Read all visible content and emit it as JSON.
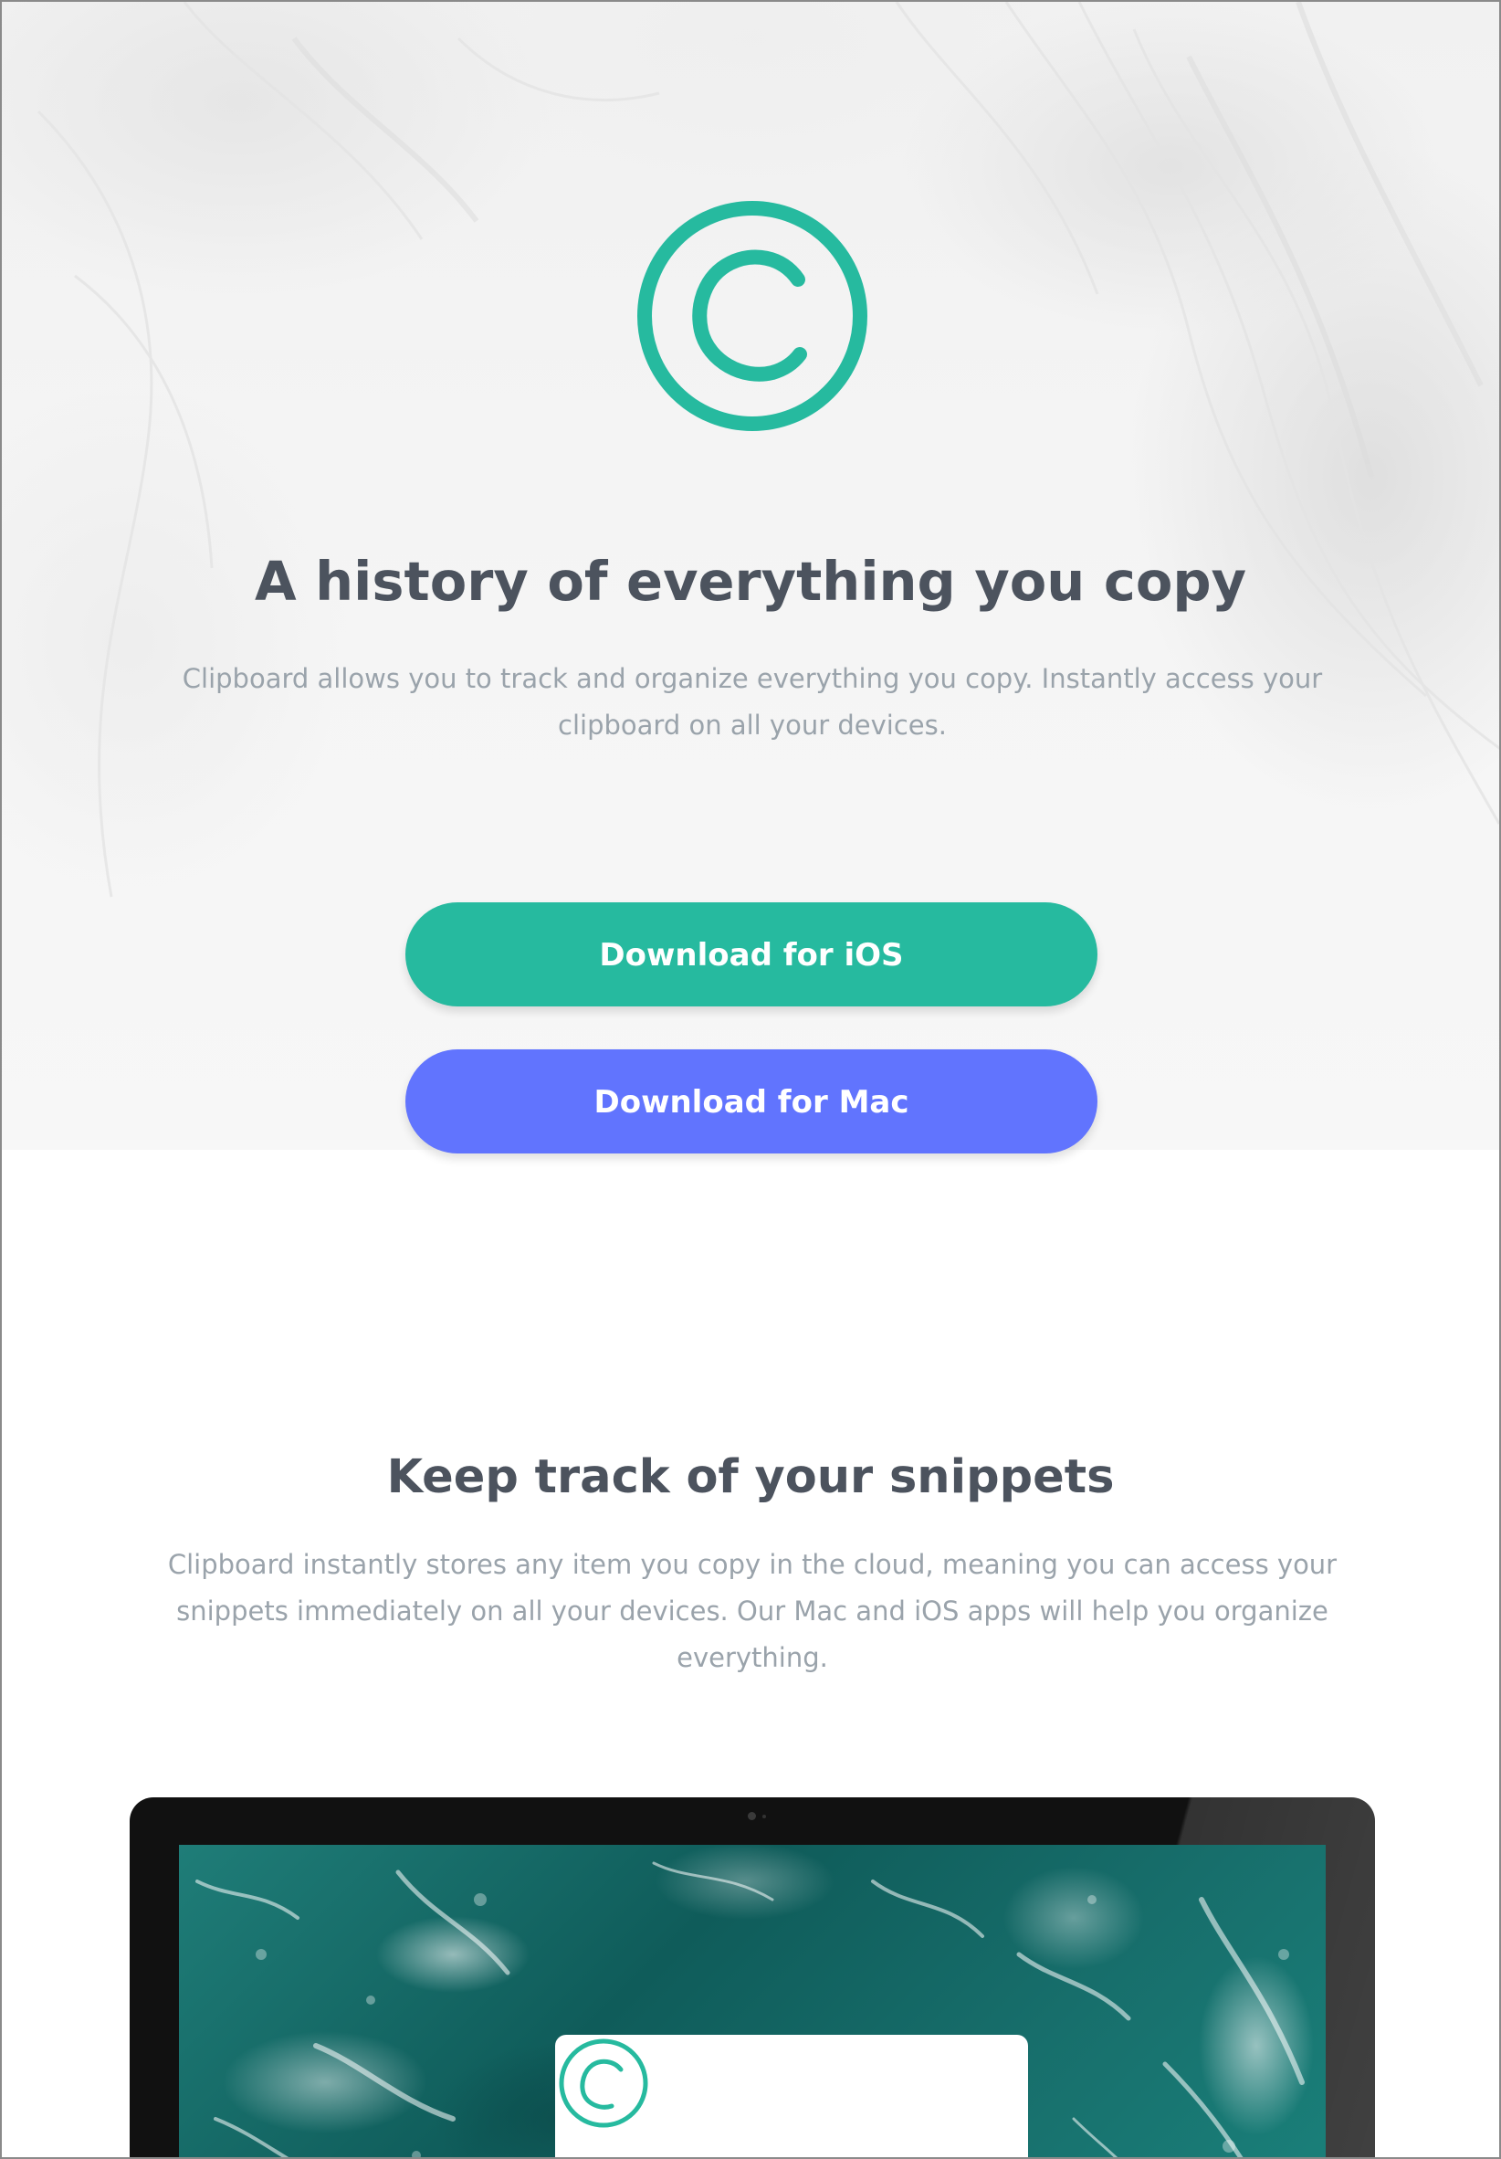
{
  "colors": {
    "accent_green": "#26ba9f",
    "accent_blue": "#6174fe",
    "heading": "#4c535e",
    "body_text": "#9aa3ab"
  },
  "hero": {
    "logo_icon": "copyright-c-logo-icon",
    "title": "A history of everything you copy",
    "description": "Clipboard allows you to track and organize everything you copy. Instantly access your clipboard on all your devices.",
    "buttons": {
      "ios_label": "Download for iOS",
      "mac_label": "Download for Mac"
    }
  },
  "snippets": {
    "title": "Keep track of your snippets",
    "description": "Clipboard instantly stores any item you copy in the cloud, meaning you can access your snippets immediately on all your devices. Our Mac and iOS apps will help you organize everything."
  },
  "device_mockup": {
    "device_type": "desktop-monitor",
    "screen_background": "ocean-waves-photo",
    "app_icon": "copyright-c-logo-icon"
  }
}
